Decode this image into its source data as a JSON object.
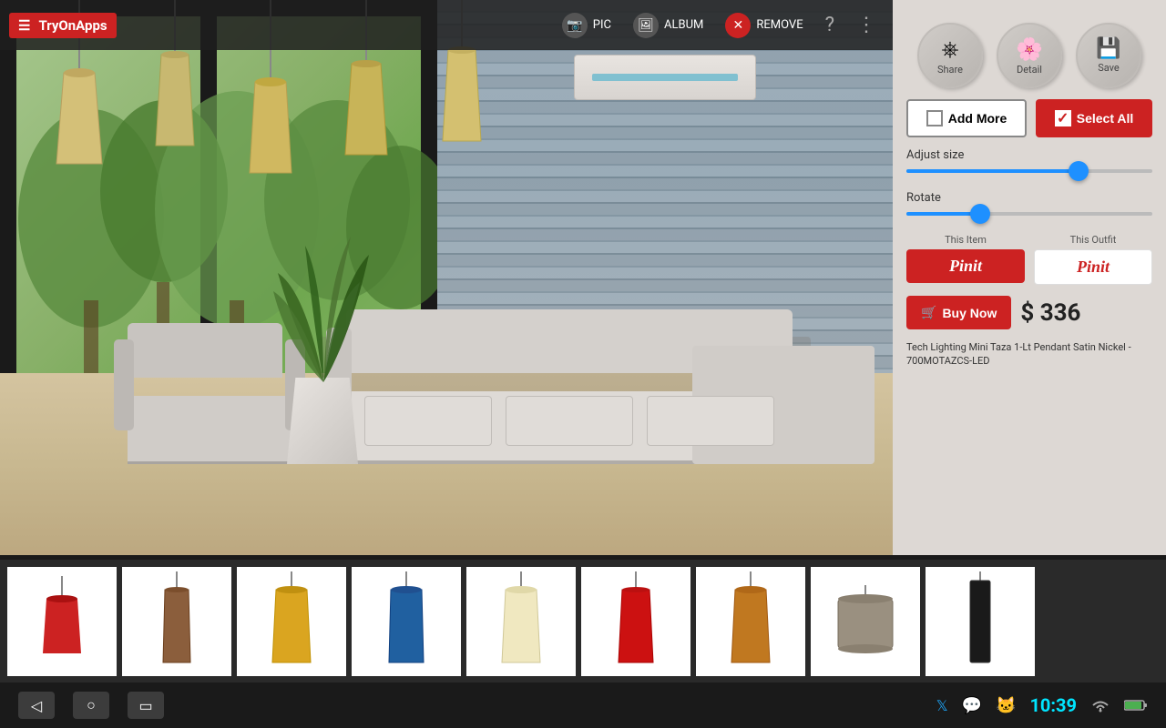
{
  "app": {
    "name": "TryOnApps",
    "menu_icon": "☰"
  },
  "toolbar": {
    "pic_label": "PIC",
    "album_label": "ALBUM",
    "remove_label": "REMOVE"
  },
  "controls": {
    "share_label": "Share",
    "detail_label": "Detail",
    "save_label": "Save",
    "add_more_label": "Add More",
    "select_all_label": "Select All",
    "adjust_size_label": "Adjust size",
    "rotate_label": "Rotate",
    "this_item_label": "This Item",
    "this_outfit_label": "This Outfit",
    "pinit_label": "Pinit",
    "buy_now_label": "Buy Now",
    "price": "$ 336",
    "product_name": "Tech Lighting Mini Taza 1-Lt Pendant Satin Nickel - 700MOTAZCS-LED",
    "adjust_size_pct": 70,
    "rotate_pct": 30
  },
  "thumbnails": [
    {
      "id": 1,
      "color": "#cc2222",
      "shape": "cone-short"
    },
    {
      "id": 2,
      "color": "#8B4513",
      "shape": "cone-tall"
    },
    {
      "id": 3,
      "color": "#DAA520",
      "shape": "cone-swirl"
    },
    {
      "id": 4,
      "color": "#1e90ff",
      "shape": "cone-blue"
    },
    {
      "id": 5,
      "color": "#f5e0a0",
      "shape": "cone-plain"
    },
    {
      "id": 6,
      "color": "#cc2222",
      "shape": "cone-red2"
    },
    {
      "id": 7,
      "color": "#8B4513",
      "shape": "cone-orange"
    },
    {
      "id": 8,
      "color": "#888",
      "shape": "drum-shade"
    },
    {
      "id": 9,
      "color": "#222",
      "shape": "cylinder-dark"
    }
  ],
  "status_bar": {
    "time": "10:39",
    "twitter_icon": "𝕏",
    "chat_icon": "💬",
    "user_icon": "👤",
    "wifi_icon": "wifi",
    "battery_icon": "battery"
  }
}
